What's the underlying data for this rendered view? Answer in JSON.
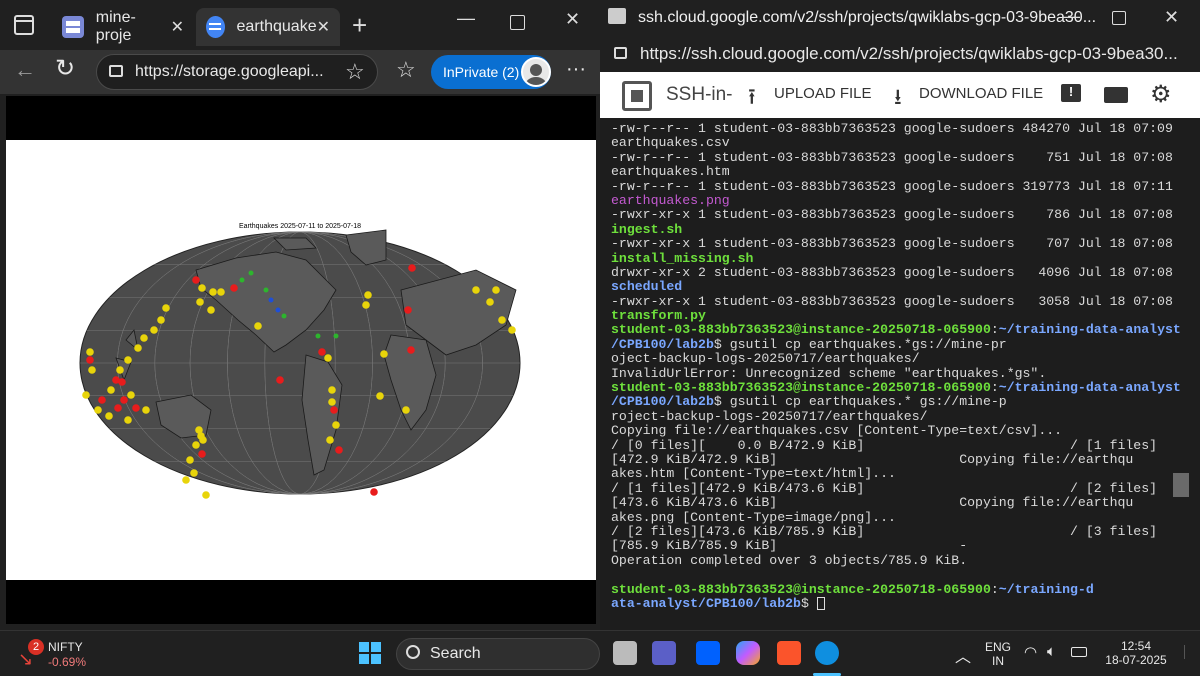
{
  "edge": {
    "tabs": [
      {
        "label": "mine-proje"
      },
      {
        "label": "earthquake"
      }
    ],
    "url": "https://storage.googleapi...",
    "inprivate_label": "InPrivate (2)",
    "chart": {
      "title": "Earthquakes 2025-07-11 to 2025-07-18",
      "colors": {
        "ocean": "#4a4a4a",
        "land": "#4a4a4a",
        "yellow": "#e8d40a",
        "red": "#e81c1c",
        "green": "#2db52d",
        "blue": "#1f4fd6"
      }
    }
  },
  "ssh": {
    "title": "ssh.cloud.google.com/v2/ssh/projects/qwiklabs-gcp-03-9bea30...",
    "url": "https://ssh.cloud.google.com/v2/ssh/projects/qwiklabs-gcp-03-9bea30...",
    "toolbar": {
      "app_label": "SSH-in-b",
      "upload_label": "UPLOAD FILE",
      "download_label": "DOWNLOAD FILE"
    },
    "terminal_lines": [
      {
        "parts": [
          {
            "t": "-rw-r--r-- 1 student-03-883bb7363523 google-sudoers 484270 Jul 18 07:09",
            "c": ""
          }
        ]
      },
      {
        "parts": [
          {
            "t": "earthquakes.csv",
            "c": ""
          }
        ]
      },
      {
        "parts": [
          {
            "t": "-rw-r--r-- 1 student-03-883bb7363523 google-sudoers    751 Jul 18 07:08",
            "c": ""
          }
        ]
      },
      {
        "parts": [
          {
            "t": "earthquakes.htm",
            "c": ""
          }
        ]
      },
      {
        "parts": [
          {
            "t": "-rw-r--r-- 1 student-03-883bb7363523 google-sudoers 319773 Jul 18 07:11",
            "c": ""
          }
        ]
      },
      {
        "parts": [
          {
            "t": "earthquakes.png",
            "c": "m"
          }
        ]
      },
      {
        "parts": [
          {
            "t": "-rwxr-xr-x 1 student-03-883bb7363523 google-sudoers    786 Jul 18 07:08",
            "c": ""
          }
        ]
      },
      {
        "parts": [
          {
            "t": "ingest.sh",
            "c": "g"
          }
        ]
      },
      {
        "parts": [
          {
            "t": "-rwxr-xr-x 1 student-03-883bb7363523 google-sudoers    707 Jul 18 07:08",
            "c": ""
          }
        ]
      },
      {
        "parts": [
          {
            "t": "install_missing.sh",
            "c": "g"
          }
        ]
      },
      {
        "parts": [
          {
            "t": "drwxr-xr-x 2 student-03-883bb7363523 google-sudoers   4096 Jul 18 07:08",
            "c": ""
          }
        ]
      },
      {
        "parts": [
          {
            "t": "scheduled",
            "c": "b"
          }
        ]
      },
      {
        "parts": [
          {
            "t": "-rwxr-xr-x 1 student-03-883bb7363523 google-sudoers   3058 Jul 18 07:08",
            "c": ""
          }
        ]
      },
      {
        "parts": [
          {
            "t": "transform.py",
            "c": "g"
          }
        ]
      },
      {
        "parts": [
          {
            "t": "student-03-883bb7363523@instance-20250718-065900",
            "c": "g"
          },
          {
            "t": ":",
            "c": ""
          },
          {
            "t": "~/training-data-analyst",
            "c": "b"
          }
        ]
      },
      {
        "parts": [
          {
            "t": "/CPB100/lab2b",
            "c": "b"
          },
          {
            "t": "$ gsutil cp earthquakes.*gs://mine-pr",
            "c": ""
          }
        ]
      },
      {
        "parts": [
          {
            "t": "oject-backup-logs-20250717/earthquakes/",
            "c": ""
          }
        ]
      },
      {
        "parts": [
          {
            "t": "InvalidUrlError: Unrecognized scheme \"earthquakes.*gs\".",
            "c": ""
          }
        ]
      },
      {
        "parts": [
          {
            "t": "student-03-883bb7363523@instance-20250718-065900",
            "c": "g"
          },
          {
            "t": ":",
            "c": ""
          },
          {
            "t": "~/training-data-analyst",
            "c": "b"
          }
        ]
      },
      {
        "parts": [
          {
            "t": "/CPB100/lab2b",
            "c": "b"
          },
          {
            "t": "$ gsutil cp earthquakes.* gs://mine-p",
            "c": ""
          }
        ]
      },
      {
        "parts": [
          {
            "t": "roject-backup-logs-20250717/earthquakes/",
            "c": ""
          }
        ]
      },
      {
        "parts": [
          {
            "t": "Copying file://earthquakes.csv [Content-Type=text/csv]...",
            "c": ""
          }
        ]
      },
      {
        "parts": [
          {
            "t": "/ [0 files][    0.0 B/472.9 KiB]                          / [1 files]",
            "c": ""
          }
        ]
      },
      {
        "parts": [
          {
            "t": "[472.9 KiB/472.9 KiB]                       Copying file://earthqu",
            "c": ""
          }
        ]
      },
      {
        "parts": [
          {
            "t": "akes.htm [Content-Type=text/html]...",
            "c": ""
          }
        ]
      },
      {
        "parts": [
          {
            "t": "/ [1 files][472.9 KiB/473.6 KiB]                          / [2 files]",
            "c": ""
          }
        ]
      },
      {
        "parts": [
          {
            "t": "[473.6 KiB/473.6 KiB]                       Copying file://earthqu",
            "c": ""
          }
        ]
      },
      {
        "parts": [
          {
            "t": "akes.png [Content-Type=image/png]...",
            "c": ""
          }
        ]
      },
      {
        "parts": [
          {
            "t": "/ [2 files][473.6 KiB/785.9 KiB]                          / [3 files]",
            "c": ""
          }
        ]
      },
      {
        "parts": [
          {
            "t": "[785.9 KiB/785.9 KiB]                       -",
            "c": ""
          }
        ]
      },
      {
        "parts": [
          {
            "t": "Operation completed over 3 objects/785.9 KiB.",
            "c": ""
          }
        ]
      },
      {
        "parts": [
          {
            "t": "",
            "c": ""
          }
        ]
      },
      {
        "parts": [
          {
            "t": "student-03-883bb7363523@instance-20250718-065900",
            "c": "g"
          },
          {
            "t": ":",
            "c": ""
          },
          {
            "t": "~/training-d",
            "c": "b"
          }
        ]
      },
      {
        "parts": [
          {
            "t": "ata-analyst/CPB100/lab2b",
            "c": "b"
          },
          {
            "t": "$ ",
            "c": ""
          },
          {
            "t": "▏",
            "c": "cursor"
          }
        ]
      }
    ]
  },
  "taskbar": {
    "stock_badge": "2",
    "stock_name": "NIFTY",
    "stock_change": "-0.69%",
    "search_label": "Search",
    "lang_line1": "ENG",
    "lang_line2": "IN",
    "time": "12:54",
    "date": "18-07-2025"
  },
  "icons": {
    "edge_sidebar": "sidebar-icon",
    "edge_refresh": "refresh-icon",
    "edge_back": "back-arrow-icon",
    "edge_star": "star-icon",
    "edge_favorites": "favorites-icon",
    "edge_menu": "more-icon",
    "lock": "lock-icon",
    "ssh_upload": "upload-icon",
    "ssh_download": "download-icon",
    "ssh_feedback": "feedback-icon",
    "ssh_keyboard": "keyboard-icon",
    "ssh_settings": "gear-icon"
  }
}
